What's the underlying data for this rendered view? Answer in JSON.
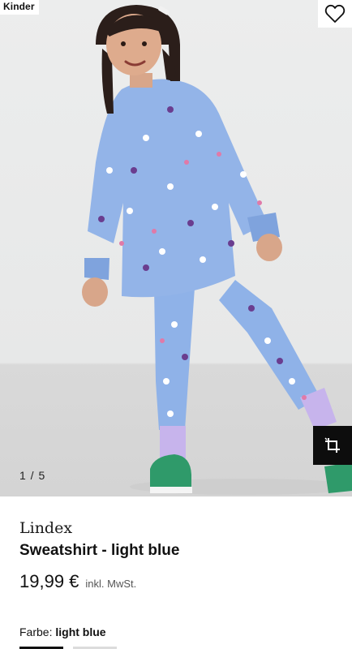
{
  "gallery": {
    "category_tag": "Kinder",
    "counter": "1 / 5",
    "favorite_icon": "heart-outline-icon",
    "crop_icon": "crop-icon"
  },
  "product": {
    "brand": "Lindex",
    "name": "Sweatshirt - light blue",
    "price": "19,99 €",
    "tax_note": "inkl. MwSt."
  },
  "color": {
    "label": "Farbe:",
    "value": "light blue"
  }
}
